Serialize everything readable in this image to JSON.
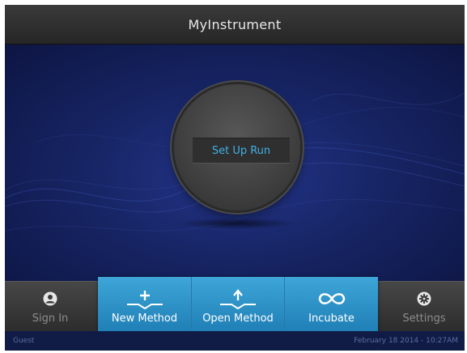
{
  "app": {
    "title": "MyInstrument"
  },
  "main": {
    "run_button": "Set Up Run"
  },
  "toolbar": {
    "sign_in": {
      "label": "Sign In",
      "icon": "user-icon"
    },
    "new_method": {
      "label": "New Method",
      "icon": "plus-arrow-icon"
    },
    "open_method": {
      "label": "Open Method",
      "icon": "up-arrow-icon"
    },
    "incubate": {
      "label": "Incubate",
      "icon": "infinity-icon"
    },
    "settings": {
      "label": "Settings",
      "icon": "gear-icon"
    }
  },
  "status": {
    "user": "Guest",
    "datetime": "February 18 2014 - 10:27AM"
  },
  "colors": {
    "accent_blue": "#3ea6d8",
    "run_text": "#3fb2e8",
    "background": "#172565"
  }
}
